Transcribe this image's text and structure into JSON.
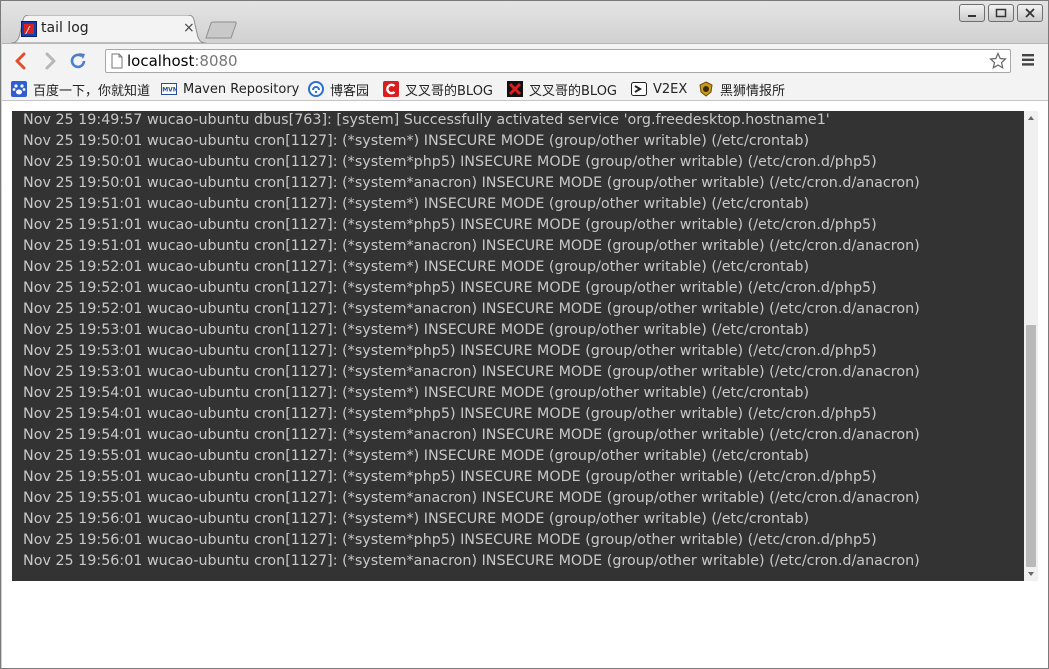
{
  "window": {
    "controls": [
      "minimize",
      "maximize",
      "close"
    ]
  },
  "tab": {
    "title": "tail log",
    "close_glyph": "×",
    "favicon": "app-favicon-icon"
  },
  "toolbar": {
    "url_host": "localhost",
    "url_port": ":8080",
    "icons": [
      "back-icon",
      "forward-icon",
      "reload-icon",
      "page-icon",
      "star-icon",
      "menu-icon"
    ]
  },
  "bookmarks": [
    {
      "label": "百度一下，你就知道",
      "icon": "paw-icon"
    },
    {
      "label": "Maven Repository",
      "icon": "mvn-icon"
    },
    {
      "label": "博客园",
      "icon": "cnblogs-icon"
    },
    {
      "label": "叉叉哥的BLOG",
      "icon": "csdn-icon"
    },
    {
      "label": "叉叉哥的BLOG",
      "icon": "red-x-icon"
    },
    {
      "label": "V2EX",
      "icon": "v2ex-icon"
    },
    {
      "label": "黑狮情报所",
      "icon": "lion-icon"
    }
  ],
  "log": [
    "Nov 25 19:49:57 wucao-ubuntu dbus[763]: [system] Successfully activated service 'org.freedesktop.hostname1'",
    "Nov 25 19:50:01 wucao-ubuntu cron[1127]: (*system*) INSECURE MODE (group/other writable) (/etc/crontab)",
    "Nov 25 19:50:01 wucao-ubuntu cron[1127]: (*system*php5) INSECURE MODE (group/other writable) (/etc/cron.d/php5)",
    "Nov 25 19:50:01 wucao-ubuntu cron[1127]: (*system*anacron) INSECURE MODE (group/other writable) (/etc/cron.d/anacron)",
    "Nov 25 19:51:01 wucao-ubuntu cron[1127]: (*system*) INSECURE MODE (group/other writable) (/etc/crontab)",
    "Nov 25 19:51:01 wucao-ubuntu cron[1127]: (*system*php5) INSECURE MODE (group/other writable) (/etc/cron.d/php5)",
    "Nov 25 19:51:01 wucao-ubuntu cron[1127]: (*system*anacron) INSECURE MODE (group/other writable) (/etc/cron.d/anacron)",
    "Nov 25 19:52:01 wucao-ubuntu cron[1127]: (*system*) INSECURE MODE (group/other writable) (/etc/crontab)",
    "Nov 25 19:52:01 wucao-ubuntu cron[1127]: (*system*php5) INSECURE MODE (group/other writable) (/etc/cron.d/php5)",
    "Nov 25 19:52:01 wucao-ubuntu cron[1127]: (*system*anacron) INSECURE MODE (group/other writable) (/etc/cron.d/anacron)",
    "Nov 25 19:53:01 wucao-ubuntu cron[1127]: (*system*) INSECURE MODE (group/other writable) (/etc/crontab)",
    "Nov 25 19:53:01 wucao-ubuntu cron[1127]: (*system*php5) INSECURE MODE (group/other writable) (/etc/cron.d/php5)",
    "Nov 25 19:53:01 wucao-ubuntu cron[1127]: (*system*anacron) INSECURE MODE (group/other writable) (/etc/cron.d/anacron)",
    "Nov 25 19:54:01 wucao-ubuntu cron[1127]: (*system*) INSECURE MODE (group/other writable) (/etc/crontab)",
    "Nov 25 19:54:01 wucao-ubuntu cron[1127]: (*system*php5) INSECURE MODE (group/other writable) (/etc/cron.d/php5)",
    "Nov 25 19:54:01 wucao-ubuntu cron[1127]: (*system*anacron) INSECURE MODE (group/other writable) (/etc/cron.d/anacron)",
    "Nov 25 19:55:01 wucao-ubuntu cron[1127]: (*system*) INSECURE MODE (group/other writable) (/etc/crontab)",
    "Nov 25 19:55:01 wucao-ubuntu cron[1127]: (*system*php5) INSECURE MODE (group/other writable) (/etc/cron.d/php5)",
    "Nov 25 19:55:01 wucao-ubuntu cron[1127]: (*system*anacron) INSECURE MODE (group/other writable) (/etc/cron.d/anacron)",
    "Nov 25 19:56:01 wucao-ubuntu cron[1127]: (*system*) INSECURE MODE (group/other writable) (/etc/crontab)",
    "Nov 25 19:56:01 wucao-ubuntu cron[1127]: (*system*php5) INSECURE MODE (group/other writable) (/etc/cron.d/php5)",
    "Nov 25 19:56:01 wucao-ubuntu cron[1127]: (*system*anacron) INSECURE MODE (group/other writable) (/etc/cron.d/anacron)"
  ],
  "colors": {
    "terminal_bg": "#333333",
    "terminal_text": "#c8c8c8",
    "page_bg": "#ffffff"
  }
}
